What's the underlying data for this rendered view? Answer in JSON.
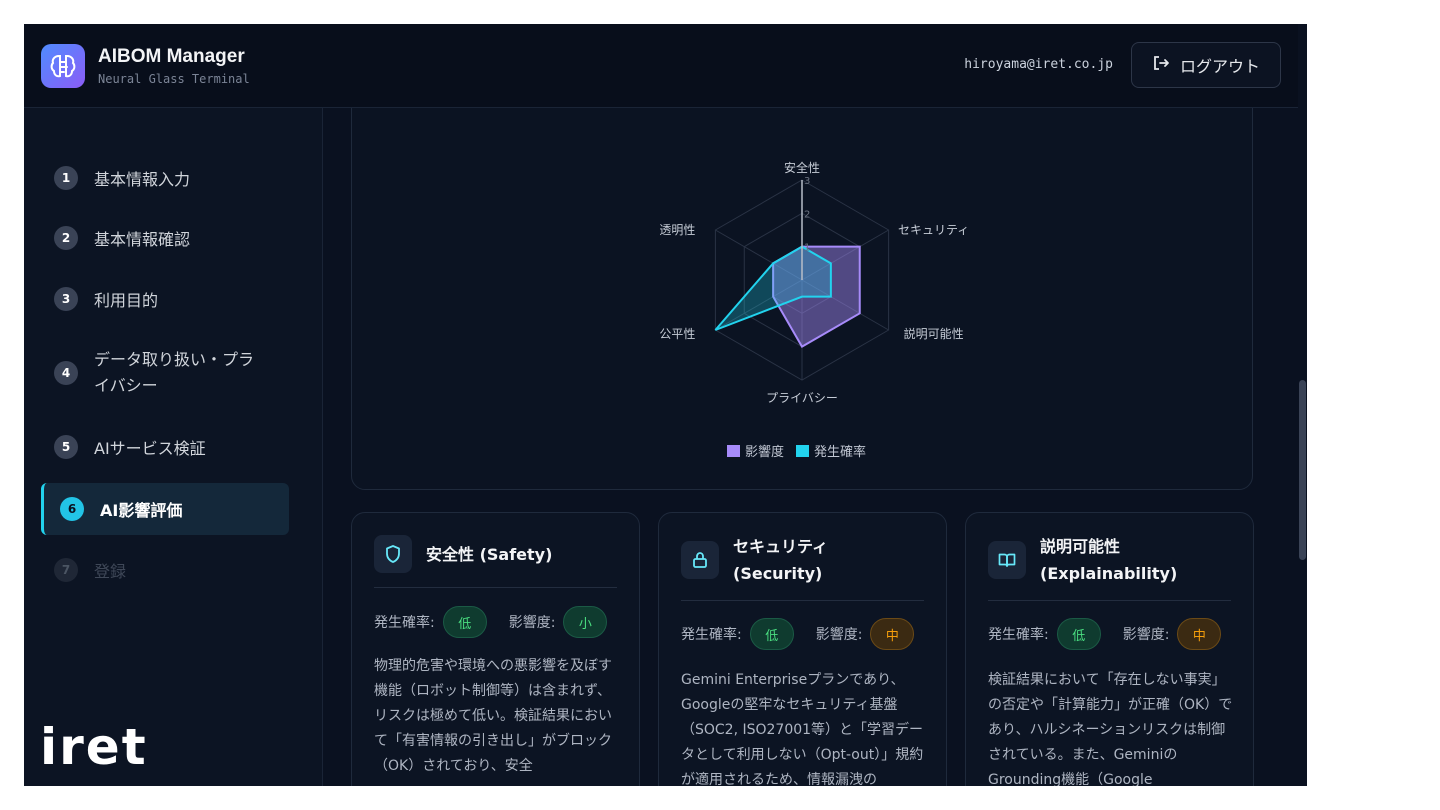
{
  "header": {
    "app_title": "AIBOM Manager",
    "app_subtitle": "Neural Glass Terminal",
    "user_email": "hiroyama@iret.co.jp",
    "logout_label": "ログアウト"
  },
  "sidebar": {
    "steps": [
      {
        "num": "1",
        "label": "基本情報入力",
        "state": "done"
      },
      {
        "num": "2",
        "label": "基本情報確認",
        "state": "done"
      },
      {
        "num": "3",
        "label": "利用目的",
        "state": "done"
      },
      {
        "num": "4",
        "label": "データ取り扱い・プライバシー",
        "label_line1": "データ取り扱い・プラ",
        "label_line2": "イバシー",
        "state": "done"
      },
      {
        "num": "5",
        "label": "AIサービス検証",
        "state": "done"
      },
      {
        "num": "6",
        "label": "AI影響評価",
        "state": "active"
      },
      {
        "num": "7",
        "label": "登録",
        "state": "disabled"
      }
    ],
    "brand_logo_text": "iret"
  },
  "chart_data": {
    "type": "radar",
    "axes": [
      "安全性",
      "セキュリティ",
      "説明可能性",
      "プライバシー",
      "公平性",
      "透明性"
    ],
    "scale_ticks": [
      "1",
      "2",
      "3"
    ],
    "rmax": 3,
    "series": [
      {
        "name": "影響度",
        "values": [
          1,
          2,
          2,
          2,
          1,
          1
        ],
        "color": "#a78bfa"
      },
      {
        "name": "発生確率",
        "values": [
          1,
          1,
          1,
          0.5,
          3,
          1
        ],
        "color": "#22d3ee"
      }
    ],
    "legend_position": "bottom"
  },
  "risk_cards": [
    {
      "title": "安全性 (Safety)",
      "icon": "shield-icon",
      "probability_label": "発生確率:",
      "probability_value": "低",
      "impact_label": "影響度:",
      "impact_value": "小",
      "body": "物理的危害や環境への悪影響を及ぼす機能（ロボット制御等）は含まれず、リスクは極めて低い。検証結果において「有害情報の引き出し」がブロック（OK）されており、安全"
    },
    {
      "title": "セキュリティ (Security)",
      "title_line1": "セキュリティ",
      "title_line2": "(Security)",
      "icon": "lock-icon",
      "probability_label": "発生確率:",
      "probability_value": "低",
      "impact_label": "影響度:",
      "impact_value": "中",
      "body": "Gemini Enterpriseプランであり、Googleの堅牢なセキュリティ基盤（SOC2, ISO27001等）と「学習データとして利用しない（Opt-out）」規約が適用されるため、情報漏洩の"
    },
    {
      "title": "説明可能性 (Explainability)",
      "title_line1": "説明可能性",
      "title_line2": "(Explainability)",
      "icon": "book-open-icon",
      "probability_label": "発生確率:",
      "probability_value": "低",
      "impact_label": "影響度:",
      "impact_value": "中",
      "body": "検証結果において「存在しない事実」の否定や「計算能力」が正確（OK）であり、ハルシネーションリスクは制御されている。また、GeminiのGrounding機能（Google"
    }
  ],
  "colors": {
    "accent_cyan": "#22d3ee",
    "accent_purple": "#a78bfa",
    "low_green": "#4ade80",
    "mid_orange": "#f59e0b",
    "bg": "#0a1120"
  }
}
